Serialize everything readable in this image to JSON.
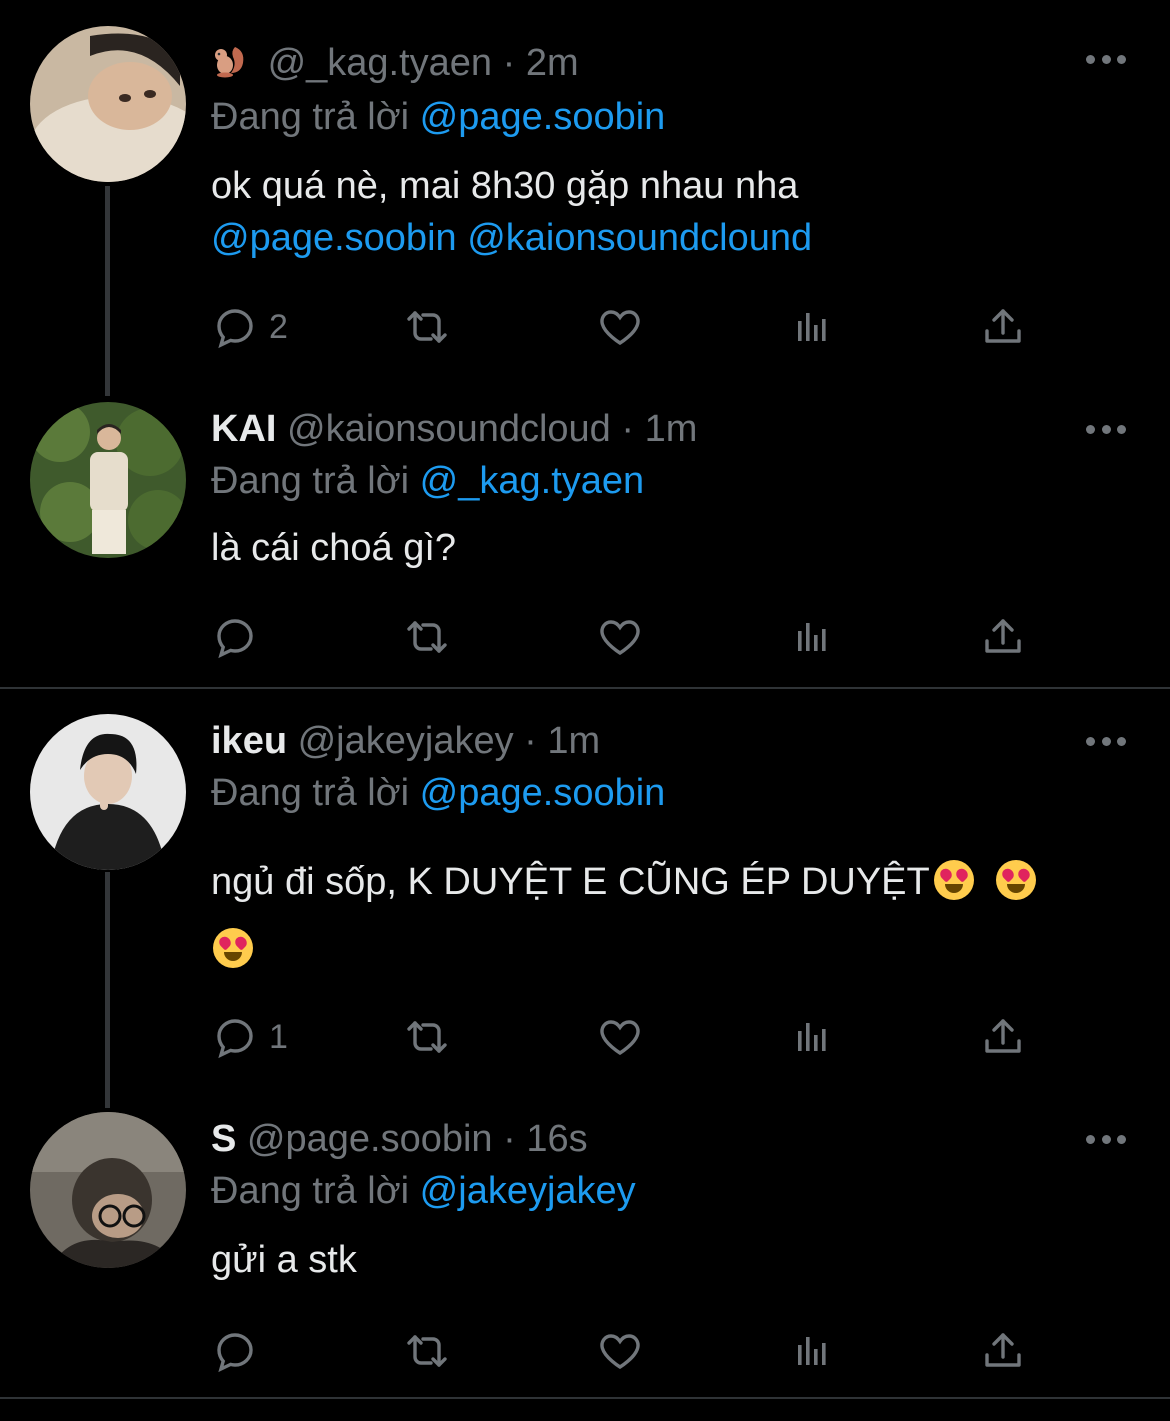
{
  "tweets": [
    {
      "display_name": "",
      "handle": "@_kag.tyaen",
      "time": "2m",
      "reply_prefix": "Đang trả lời",
      "reply_to": "@page.soobin",
      "text": "ok quá nè, mai 8h30 gặp nhau nha",
      "mentions": "@page.soobin @kaionsoundclound",
      "reply_count": "2",
      "avatar_icon": "squirrel-emoji"
    },
    {
      "display_name": "KAI",
      "handle": "@kaionsoundcloud",
      "time": "1m",
      "reply_prefix": "Đang trả lời",
      "reply_to": "@_kag.tyaen",
      "text": "là cái choá gì?",
      "reply_count": ""
    },
    {
      "display_name": "ikeu",
      "handle": "@jakeyjakey",
      "time": "1m",
      "reply_prefix": "Đang trả lời",
      "reply_to": "@page.soobin",
      "text": "ngủ đi sốp, K DUYỆT E CŨNG ÉP DUYỆT",
      "reply_count": "1",
      "emoji": "heart-eyes-emoji"
    },
    {
      "display_name": "S",
      "handle": "@page.soobin",
      "time": "16s",
      "reply_prefix": "Đang trả lời",
      "reply_to": "@jakeyjakey",
      "text": "gửi a stk",
      "reply_count": ""
    }
  ],
  "separator": " · ",
  "colors": {
    "background": "#000000",
    "text": "#e7e9ea",
    "muted": "#71767b",
    "accent": "#1d9bf0"
  }
}
